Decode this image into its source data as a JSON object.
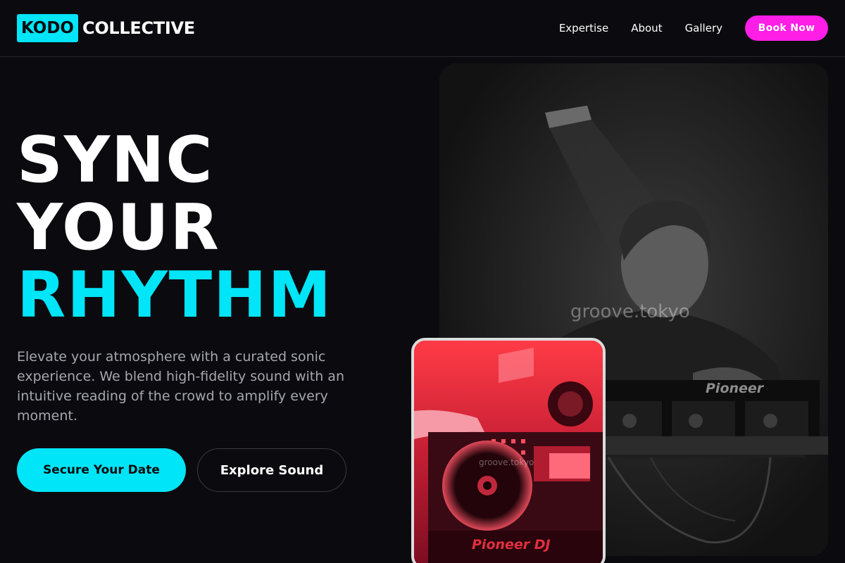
{
  "brand": {
    "box": "KODO",
    "rest": "COLLECTIVE"
  },
  "nav": {
    "links": [
      "Expertise",
      "About",
      "Gallery"
    ],
    "cta": "Book Now"
  },
  "hero": {
    "line1": "SYNC",
    "line2": "YOUR",
    "line3": "RHYTHM",
    "description": "Elevate your atmosphere with a curated sonic experience. We blend high-fidelity sound with an intuitive reading of the crowd to amplify every moment.",
    "primary_cta": "Secure Your Date",
    "secondary_cta": "Explore Sound"
  },
  "images": {
    "main_watermark": "groove.tokyo",
    "main_mixer_brand": "Pioneer",
    "small_watermark": "groove.tokyo",
    "small_mixer_brand": "Pioneer DJ"
  },
  "colors": {
    "background": "#0b0b0f",
    "accent_cyan": "#00e5f7",
    "accent_magenta": "#ff1ee6"
  }
}
